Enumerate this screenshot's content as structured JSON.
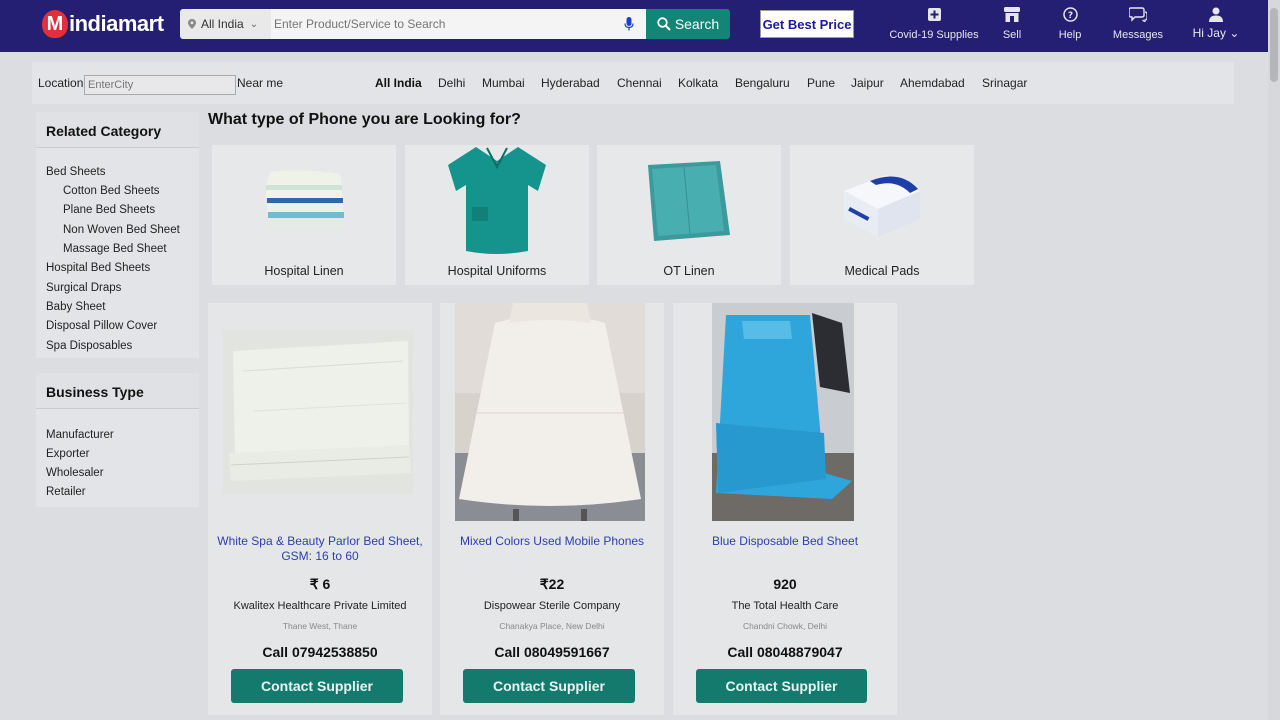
{
  "header": {
    "logo_text": "indiamart",
    "logo_letter": "M",
    "location_select": "All India",
    "search_placeholder": "Enter Product/Service to Search",
    "search_label": "Search",
    "best_price_label": "Get Best Price",
    "nav": [
      {
        "label": "Covid-19 Supplies",
        "icon": "plus-square-icon"
      },
      {
        "label": "Sell",
        "icon": "store-icon"
      },
      {
        "label": "Help",
        "icon": "help-icon"
      },
      {
        "label": "Messages",
        "icon": "chat-icon"
      },
      {
        "label": "Hi Jay",
        "icon": "user-icon"
      }
    ]
  },
  "location_bar": {
    "label": "Location",
    "city_placeholder": "EnterCity",
    "near_me": "Near me",
    "cities": [
      "All India",
      "Delhi",
      "Mumbai",
      "Hyderabad",
      "Chennai",
      "Kolkata",
      "Bengaluru",
      "Pune",
      "Jaipur",
      "Ahemdabad",
      "Srinagar"
    ],
    "active_city": "All India"
  },
  "sidebar": {
    "related_title": "Related Category",
    "related_items": [
      {
        "label": "Bed Sheets",
        "level": 0
      },
      {
        "label": "Cotton Bed Sheets",
        "level": 1
      },
      {
        "label": "Plane Bed Sheets",
        "level": 1
      },
      {
        "label": "Non Woven Bed Sheet",
        "level": 1
      },
      {
        "label": "Massage Bed Sheet",
        "level": 1
      },
      {
        "label": "Hospital Bed Sheets",
        "level": 0
      },
      {
        "label": "Surgical Draps",
        "level": 0
      },
      {
        "label": "Baby Sheet",
        "level": 0
      },
      {
        "label": "Disposal Pillow Cover",
        "level": 0
      },
      {
        "label": "Spa Disposables",
        "level": 0
      }
    ],
    "business_title": "Business Type",
    "business_items": [
      "Manufacturer",
      "Exporter",
      "Wholesaler",
      "Retailer"
    ]
  },
  "main": {
    "title": "What type of Phone you are Looking for?",
    "categories": [
      "Hospital Linen",
      "Hospital Uniforms",
      "OT Linen",
      "Medical Pads"
    ],
    "products": [
      {
        "title": "White Spa & Beauty Parlor Bed Sheet, GSM: 16 to 60",
        "price": "₹ 6",
        "company": "Kwalitex Healthcare Private Limited",
        "location": "Thane West, Thane",
        "call": "Call 07942538850",
        "cta": "Contact Supplier"
      },
      {
        "title": "Mixed Colors Used Mobile Phones",
        "price": "₹22",
        "company": "Dispowear Sterile Company",
        "location": "Chanakya Place, New Delhi",
        "call": "Call 08049591667",
        "cta": "Contact Supplier"
      },
      {
        "title": "Blue Disposable Bed Sheet",
        "price": "920",
        "company": "The Total Health Care",
        "location": "Chandni Chowk, Delhi",
        "call": "Call 08048879047",
        "cta": "Contact Supplier"
      }
    ]
  },
  "colors": {
    "header_bg": "#241f73",
    "search_btn": "#138577",
    "contact_btn": "#157a6e",
    "link": "#2a3fb0"
  }
}
